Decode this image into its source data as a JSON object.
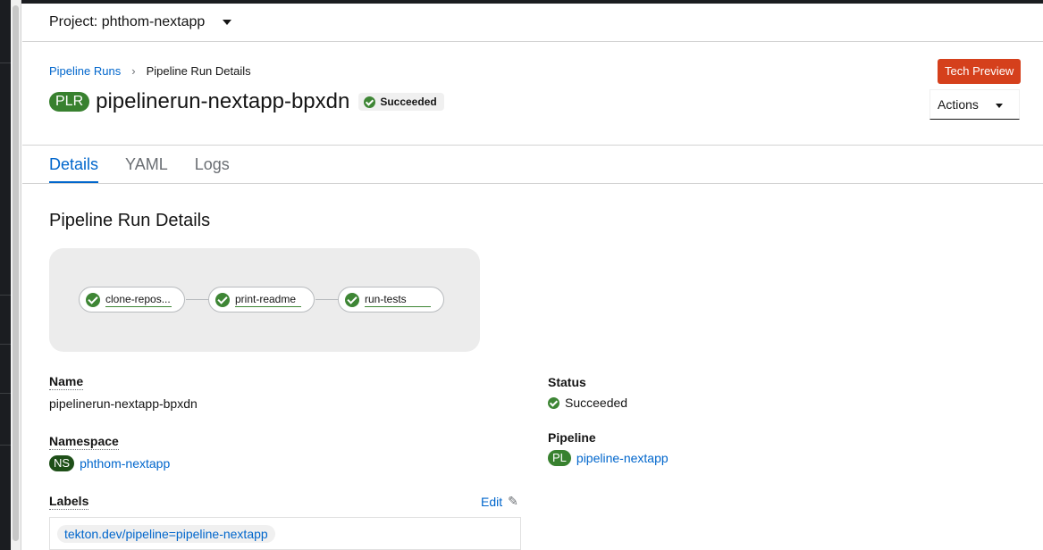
{
  "project": {
    "label": "Project: phthom-nextapp"
  },
  "breadcrumb": {
    "parent": "Pipeline Runs",
    "current": "Pipeline Run Details"
  },
  "header": {
    "badge": "PLR",
    "title": "pipelinerun-nextapp-bpxdn",
    "status": "Succeeded",
    "tech_preview": "Tech Preview",
    "actions_label": "Actions"
  },
  "tabs": [
    {
      "label": "Details",
      "active": true
    },
    {
      "label": "YAML",
      "active": false
    },
    {
      "label": "Logs",
      "active": false
    }
  ],
  "section_title": "Pipeline Run Details",
  "pipeline_graph": {
    "tasks": [
      {
        "name": "clone-repos...",
        "status": "succeeded"
      },
      {
        "name": "print-readme",
        "status": "succeeded"
      },
      {
        "name": "run-tests",
        "status": "succeeded"
      }
    ]
  },
  "details": {
    "name_label": "Name",
    "name_value": "pipelinerun-nextapp-bpxdn",
    "namespace_label": "Namespace",
    "namespace_badge": "NS",
    "namespace_value": "phthom-nextapp",
    "labels_label": "Labels",
    "edit_label": "Edit",
    "labels": [
      "tekton.dev/pipeline=pipeline-nextapp"
    ],
    "status_label": "Status",
    "status_value": "Succeeded",
    "pipeline_label": "Pipeline",
    "pipeline_badge": "PL",
    "pipeline_value": "pipeline-nextapp"
  },
  "colors": {
    "link": "#0066cc",
    "success": "#3e8635",
    "tech_preview": "#d5401c",
    "badge_green": "#38812f"
  }
}
